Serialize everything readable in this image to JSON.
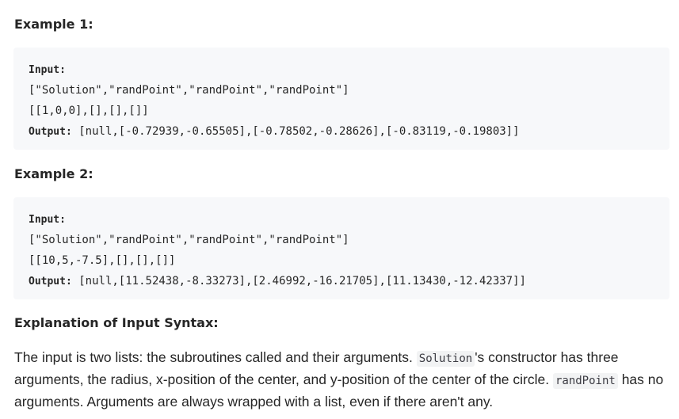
{
  "example1": {
    "heading": "Example 1:",
    "input_label": "Input:",
    "input_line1": "[\"Solution\",\"randPoint\",\"randPoint\",\"randPoint\"]",
    "input_line2": "[[1,0,0],[],[],[]]",
    "output_label": "Output:",
    "output_value": "[null,[-0.72939,-0.65505],[-0.78502,-0.28626],[-0.83119,-0.19803]]"
  },
  "example2": {
    "heading": "Example 2:",
    "input_label": "Input:",
    "input_line1": "[\"Solution\",\"randPoint\",\"randPoint\",\"randPoint\"]",
    "input_line2": "[[10,5,-7.5],[],[],[]]",
    "output_label": "Output:",
    "output_value": "[null,[11.52438,-8.33273],[2.46992,-16.21705],[11.13430,-12.42337]]"
  },
  "explanation": {
    "heading": "Explanation of Input Syntax:",
    "text_before_solution": "The input is two lists: the subroutines called and their arguments. ",
    "solution_code": "Solution",
    "text_after_solution": "'s constructor has three arguments, the radius, x-position of the center, and y-position of the center of the circle. ",
    "randpoint_code": "randPoint",
    "text_end": " has no arguments. Arguments are always wrapped with a list, even if there aren't any."
  }
}
